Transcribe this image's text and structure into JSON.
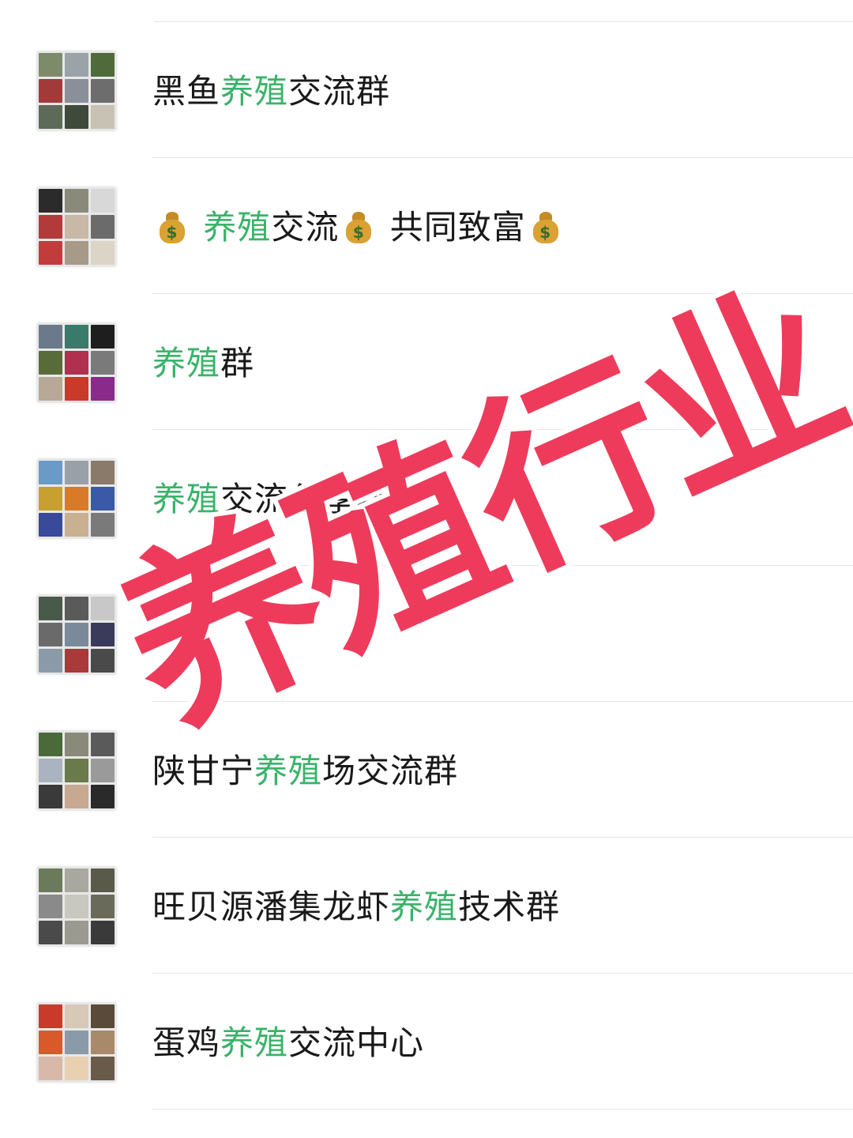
{
  "colors": {
    "highlight": "#3ab36a",
    "text": "#191919",
    "watermark": "#ee3b5c",
    "divider": "#e6e6e6"
  },
  "watermark": {
    "text": "养殖行业"
  },
  "groups": [
    {
      "pre": "黑鱼",
      "hl": "养殖",
      "post": "交流群"
    },
    {
      "lead_icon": "money-bag-icon",
      "hl": "养殖",
      "mid": "交流",
      "mid_icon": "money-bag-icon",
      "post": " 共同致富",
      "tail_icon": "money-bag-icon"
    },
    {
      "pre": "",
      "hl": "养殖",
      "post": "群"
    },
    {
      "pre": "",
      "hl": "养殖",
      "post": "交流分享群"
    },
    {
      "pre": "",
      "hl": "",
      "post": ""
    },
    {
      "pre": "陕甘宁",
      "hl": "养殖",
      "post": "场交流群"
    },
    {
      "pre": "旺贝源潘集龙虾",
      "hl": "养殖",
      "post": "技术群"
    },
    {
      "pre": "蛋鸡",
      "hl": "养殖",
      "post": "交流中心"
    }
  ]
}
